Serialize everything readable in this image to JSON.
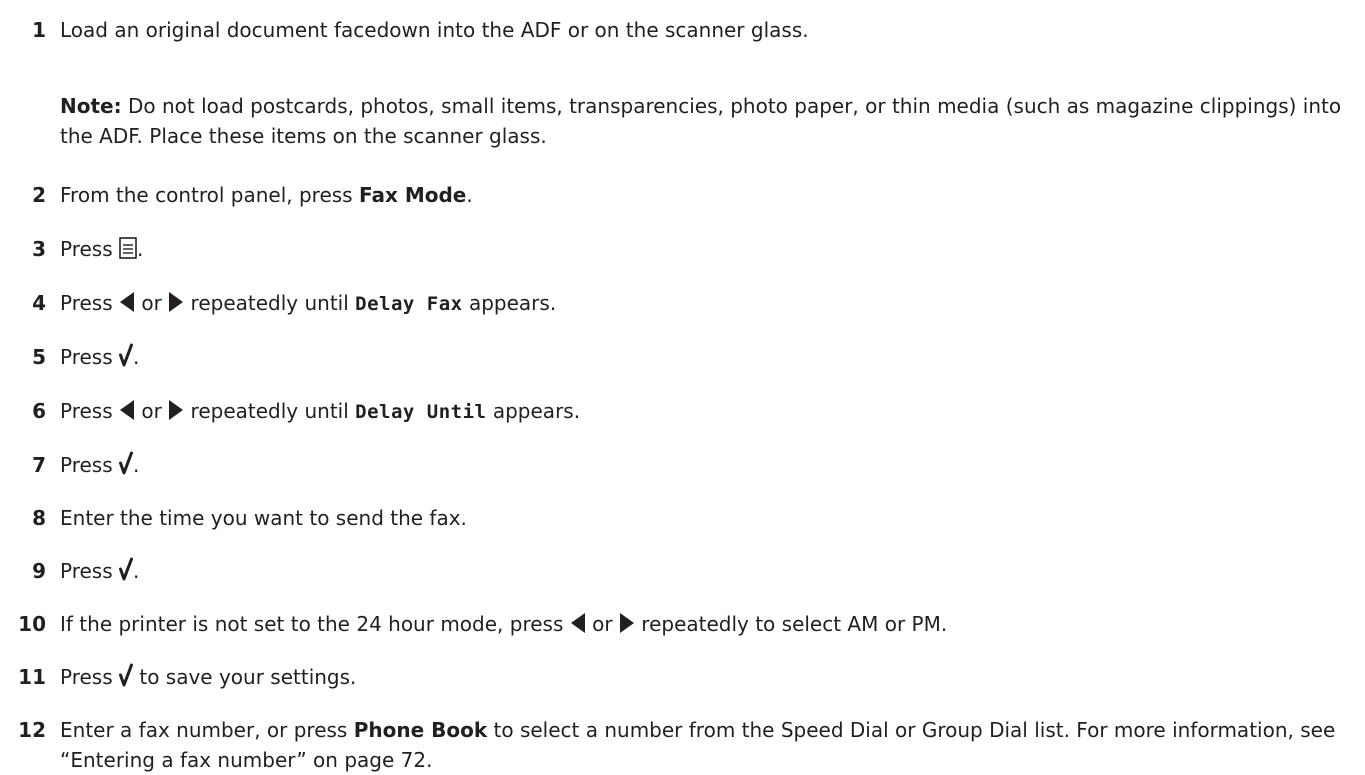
{
  "steps": [
    {
      "num": "1",
      "parts": [
        {
          "t": "Load an original document facedown into the ADF or on the scanner glass."
        }
      ]
    },
    {
      "num": "2",
      "parts": [
        {
          "t": "From the control panel, press "
        },
        {
          "b": "Fax Mode"
        },
        {
          "t": "."
        }
      ]
    },
    {
      "num": "3",
      "parts": [
        {
          "t": "Press "
        },
        {
          "icon": "menu-icon"
        },
        {
          "t": "."
        }
      ]
    },
    {
      "num": "4",
      "parts": [
        {
          "t": "Press "
        },
        {
          "icon": "left-arrow-icon"
        },
        {
          "t": " or "
        },
        {
          "icon": "right-arrow-icon"
        },
        {
          "t": " repeatedly until "
        },
        {
          "m": "Delay Fax"
        },
        {
          "t": " appears."
        }
      ]
    },
    {
      "num": "5",
      "parts": [
        {
          "t": "Press "
        },
        {
          "icon": "checkmark-icon"
        },
        {
          "t": "."
        }
      ]
    },
    {
      "num": "6",
      "parts": [
        {
          "t": "Press "
        },
        {
          "icon": "left-arrow-icon"
        },
        {
          "t": " or "
        },
        {
          "icon": "right-arrow-icon"
        },
        {
          "t": " repeatedly until "
        },
        {
          "m": "Delay Until"
        },
        {
          "t": " appears."
        }
      ]
    },
    {
      "num": "7",
      "parts": [
        {
          "t": "Press "
        },
        {
          "icon": "checkmark-icon"
        },
        {
          "t": "."
        }
      ]
    },
    {
      "num": "8",
      "parts": [
        {
          "t": "Enter the time you want to send the fax."
        }
      ]
    },
    {
      "num": "9",
      "parts": [
        {
          "t": "Press "
        },
        {
          "icon": "checkmark-icon"
        },
        {
          "t": "."
        }
      ]
    },
    {
      "num": "10",
      "parts": [
        {
          "t": "If the printer is not set to the 24 hour mode, press "
        },
        {
          "icon": "left-arrow-icon"
        },
        {
          "t": " or "
        },
        {
          "icon": "right-arrow-icon"
        },
        {
          "t": " repeatedly to select AM or PM."
        }
      ]
    },
    {
      "num": "11",
      "parts": [
        {
          "t": "Press "
        },
        {
          "icon": "checkmark-icon"
        },
        {
          "t": " to save your settings."
        }
      ]
    },
    {
      "num": "12",
      "parts": [
        {
          "t": "Enter a fax number, or press "
        },
        {
          "b": "Phone Book"
        },
        {
          "t": " to select a number from the Speed Dial or Group Dial list. For more information, see “Entering a fax number” on page 72."
        }
      ]
    }
  ],
  "note": {
    "label": "Note:",
    "text": "Do not load postcards, photos, small items, transparencies, photo paper, or thin media (such as magazine clippings) into the ADF. Place these items on the scanner glass."
  }
}
